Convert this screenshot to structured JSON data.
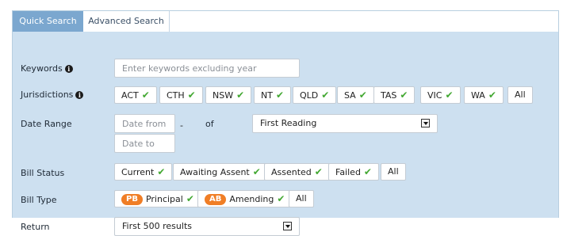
{
  "tabs": [
    {
      "label": "Quick Search",
      "active": true
    },
    {
      "label": "Advanced Search",
      "active": false
    }
  ],
  "keywords": {
    "label": "Keywords",
    "info_icon": "info-icon",
    "placeholder": "Enter keywords excluding year"
  },
  "jurisdictions": {
    "label": "Jurisdictions",
    "info_icon": "info-icon",
    "options": [
      "ACT",
      "CTH",
      "NSW",
      "NT",
      "QLD",
      "SA",
      "TAS",
      "VIC",
      "WA"
    ],
    "all_label": "All"
  },
  "date_range": {
    "label": "Date Range",
    "from_placeholder": "Date from",
    "to_placeholder": "Date to",
    "separator": "-",
    "of_label": "of",
    "stage_selected": "First Reading"
  },
  "bill_status": {
    "label": "Bill Status",
    "options": [
      "Current",
      "Awaiting Assent",
      "Assented",
      "Failed"
    ],
    "all_label": "All"
  },
  "bill_type": {
    "label": "Bill Type",
    "options": [
      {
        "badge": "PB",
        "label": "Principal"
      },
      {
        "badge": "AB",
        "label": "Amending"
      }
    ],
    "all_label": "All"
  },
  "return": {
    "label": "Return",
    "selected": "First 500 results"
  },
  "colors": {
    "tab_active": "#7ba7cf",
    "panel": "#cde0f0",
    "check": "#43a832",
    "badge": "#f07e26"
  }
}
